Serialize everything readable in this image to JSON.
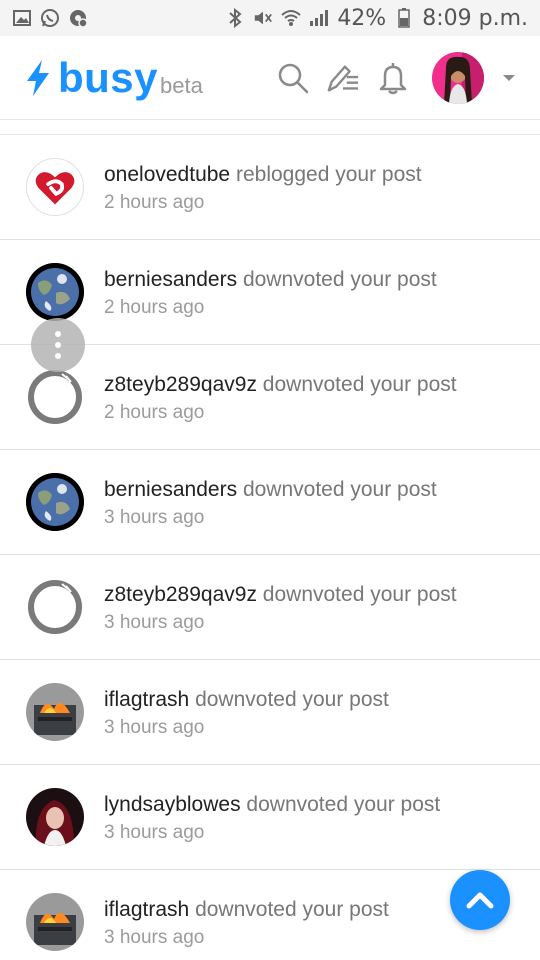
{
  "status_bar": {
    "battery": "42%",
    "time": "8:09 p.m."
  },
  "header": {
    "logo_name": "busy",
    "logo_suffix": "beta",
    "brand_color": "#1a91ff"
  },
  "notifications": [
    {
      "user": "onelovedtube",
      "action": "reblogged your post",
      "time": "2 hours ago",
      "avatar": "heart-logo"
    },
    {
      "user": "berniesanders",
      "action": "downvoted your post",
      "time": "2 hours ago",
      "avatar": "earth"
    },
    {
      "user": "z8teyb289qav9z",
      "action": "downvoted your post",
      "time": "2 hours ago",
      "avatar": "ring"
    },
    {
      "user": "berniesanders",
      "action": "downvoted your post",
      "time": "3 hours ago",
      "avatar": "earth"
    },
    {
      "user": "z8teyb289qav9z",
      "action": "downvoted your post",
      "time": "3 hours ago",
      "avatar": "ring"
    },
    {
      "user": "iflagtrash",
      "action": "downvoted your post",
      "time": "3 hours ago",
      "avatar": "dumpster-fire"
    },
    {
      "user": "lyndsayblowes",
      "action": "downvoted your post",
      "time": "3 hours ago",
      "avatar": "person"
    },
    {
      "user": "iflagtrash",
      "action": "downvoted your post",
      "time": "3 hours ago",
      "avatar": "dumpster-fire"
    }
  ]
}
